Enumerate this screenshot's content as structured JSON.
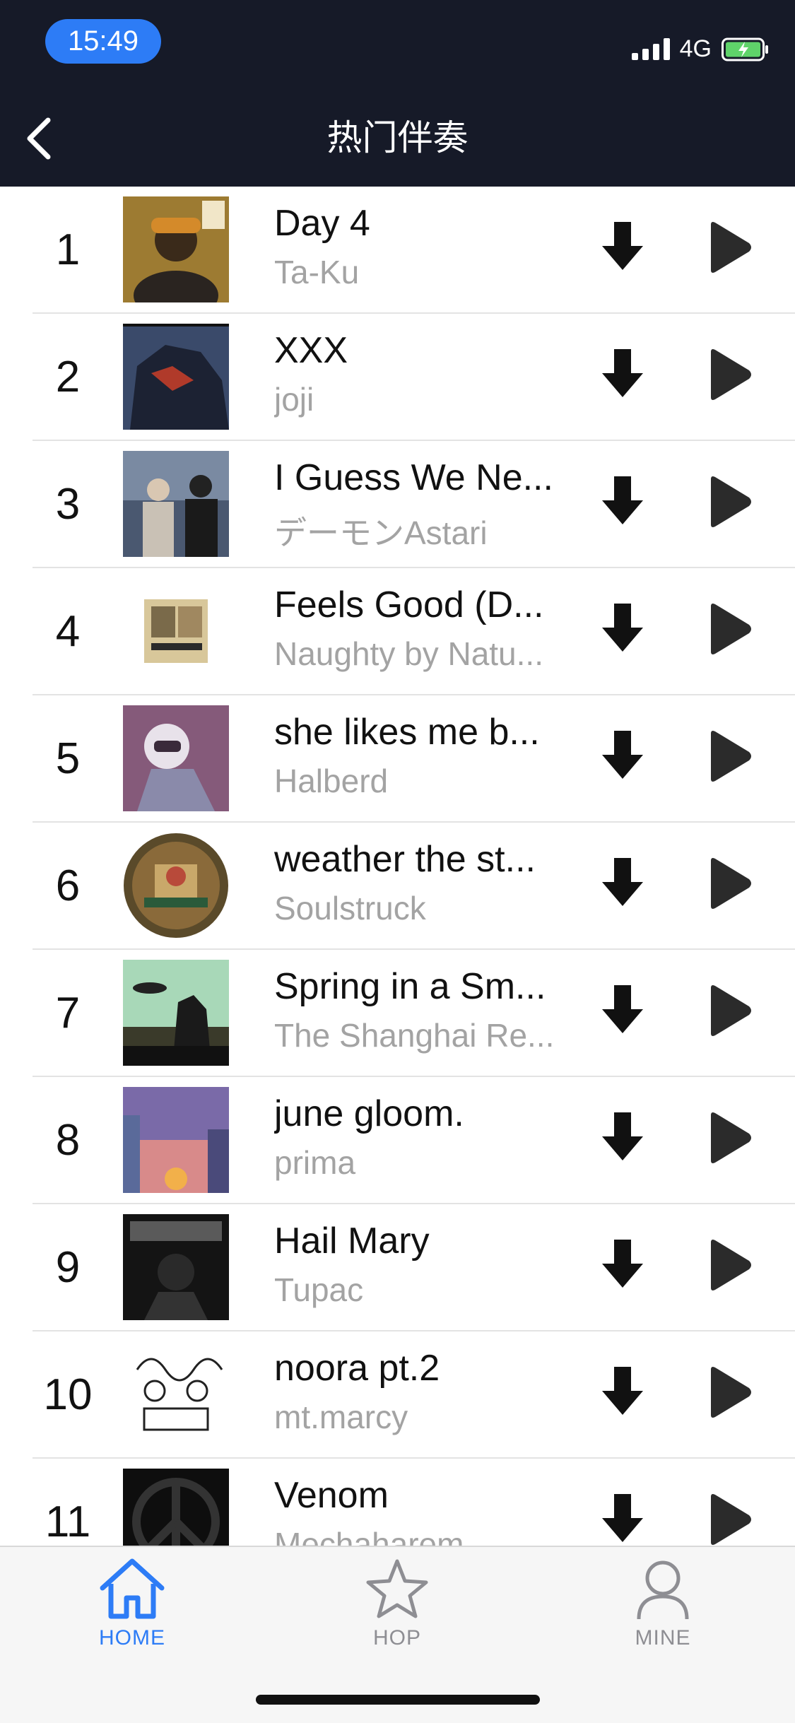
{
  "status": {
    "time": "15:49",
    "network": "4G"
  },
  "header": {
    "title": "热门伴奏"
  },
  "tracks": [
    {
      "rank": "1",
      "title": "Day 4",
      "artist": "Ta-Ku"
    },
    {
      "rank": "2",
      "title": "XXX",
      "artist": "joji"
    },
    {
      "rank": "3",
      "title": "I Guess We Ne...",
      "artist": "デーモンAstari"
    },
    {
      "rank": "4",
      "title": "Feels Good (D...",
      "artist": "Naughty by Natu..."
    },
    {
      "rank": "5",
      "title": "she likes me b...",
      "artist": "Halberd"
    },
    {
      "rank": "6",
      "title": "weather the st...",
      "artist": "Soulstruck"
    },
    {
      "rank": "7",
      "title": "Spring in a Sm...",
      "artist": "The Shanghai Re..."
    },
    {
      "rank": "8",
      "title": "june gloom.",
      "artist": "prima"
    },
    {
      "rank": "9",
      "title": "Hail Mary",
      "artist": "Tupac"
    },
    {
      "rank": "10",
      "title": "noora pt.2",
      "artist": "mt.marcy"
    },
    {
      "rank": "11",
      "title": "Venom",
      "artist": "Mechaharem"
    }
  ],
  "tabs": [
    {
      "label": "HOME",
      "icon": "home-icon",
      "active": true
    },
    {
      "label": "HOP",
      "icon": "star-icon",
      "active": false
    },
    {
      "label": "MINE",
      "icon": "person-icon",
      "active": false
    }
  ],
  "colors": {
    "accent": "#2d7cf6",
    "header_bg": "#161a28",
    "inactive_tab": "#8e8e93",
    "artist_text": "#a3a3a3"
  }
}
